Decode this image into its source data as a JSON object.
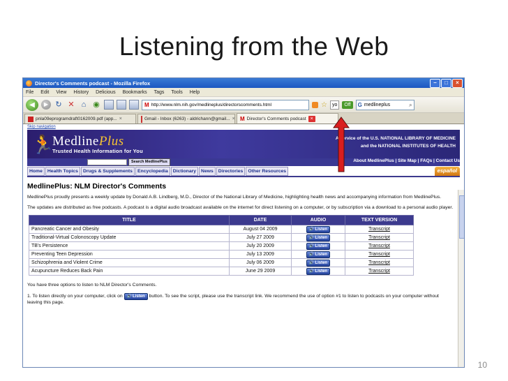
{
  "slide": {
    "title": "Listening from the Web",
    "number": "10"
  },
  "browser": {
    "window_title": "Director's Comments podcast - Mozilla Firefox",
    "menu": [
      "File",
      "Edit",
      "View",
      "History",
      "Delicious",
      "Bookmarks",
      "Tags",
      "Tools",
      "Help"
    ],
    "url": "http://www.nlm.nih.gov/medlineplus/directorscomments.html",
    "yo_label": "yo",
    "go_label": "Off",
    "search_value": "medlineplus",
    "tabs": [
      {
        "label": "pnla09eprogramdraft0162009.pdf (app..."
      },
      {
        "label": "Gmail - Inbox (6263) - aldrichann@gmail..."
      },
      {
        "label": "Director's Comments podcast"
      }
    ]
  },
  "page": {
    "skip_nav": "Skip navigation",
    "logo_main": "Medline",
    "logo_plus": "Plus",
    "tagline": "Trusted Health Information for You",
    "series_line1": "A service of the U.S. NATIONAL LIBRARY OF MEDICINE",
    "series_line2": "and the NATIONAL INSTITUTES OF HEALTH",
    "search_button": "Search MedlinePlus",
    "top_links": "About MedlinePlus | Site Map | FAQs | Contact Us",
    "nav": [
      "Home",
      "Health Topics",
      "Drugs & Supplements",
      "Encyclopedia",
      "Dictionary",
      "News",
      "Directories",
      "Other Resources"
    ],
    "espanol": "español",
    "heading": "MedlinePlus: NLM Director's Comments",
    "para1": "MedlinePlus proudly presents a weekly update by Donald A.B. Lindberg, M.D., Director of the National Library of Medicine, highlighting health news and accompanying information from MedlinePlus.",
    "para2": "The updates are distributed as free podcasts. A podcast is a digital audio broadcast available on the internet for direct listening on a computer, or by subscription via a download to a personal audio player.",
    "table": {
      "headers": [
        "TITLE",
        "DATE",
        "AUDIO",
        "TEXT VERSION"
      ],
      "listen_label": "Listen",
      "transcript_label": "Transcript",
      "rows": [
        {
          "title": "Pancreatic Cancer and Obesity",
          "date": "August 04 2009"
        },
        {
          "title": "Traditional-Virtual Colonoscopy Update",
          "date": "July 27 2009"
        },
        {
          "title": "TB's Persistence",
          "date": "July 20 2009"
        },
        {
          "title": "Preventing Teen Depression",
          "date": "July 13 2009"
        },
        {
          "title": "Schizophrenia and Violent Crime",
          "date": "July 06 2009"
        },
        {
          "title": "Acupuncture Reduces Back Pain",
          "date": "June 29 2009"
        }
      ]
    },
    "para3": "You have three options to listen to NLM Director's Comments.",
    "opt1_before": "1. To listen directly on your computer, click on",
    "opt1_after": "button. To see the script, please use the transcript link. We recommend the use of option #1 to listen to podcasts on your computer without leaving this page."
  },
  "colors": {
    "banner": "#3f3a9e",
    "nav_border": "#3c3a8e",
    "arrow": "#d91e1e",
    "espanol": "#e08a1c"
  }
}
